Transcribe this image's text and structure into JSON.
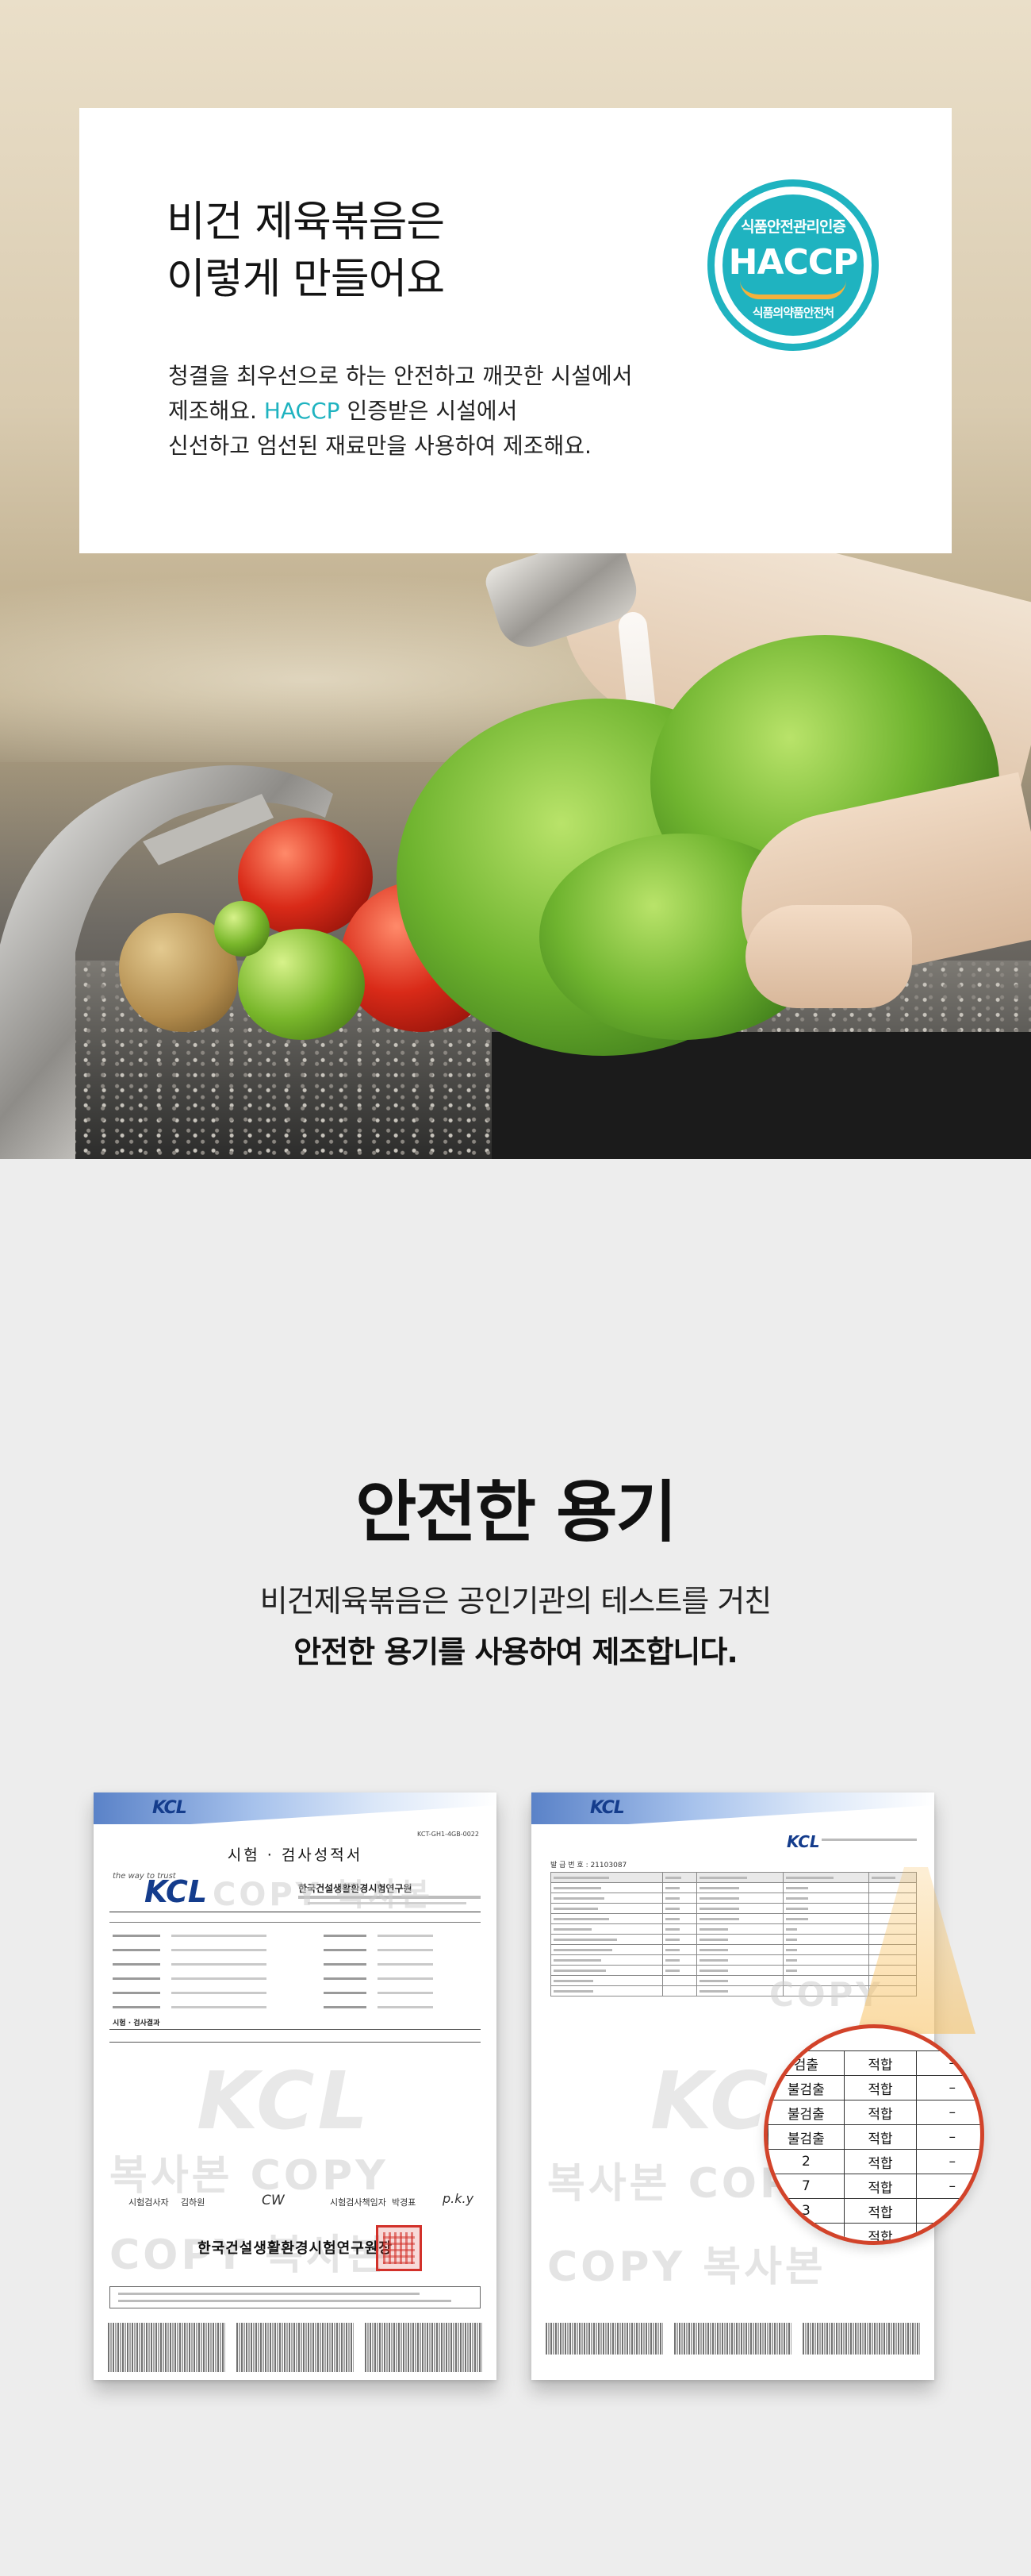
{
  "haccp_card": {
    "title_line1": "비건 제육볶음은",
    "title_line2": "이렇게 만들어요",
    "body_line1": "청결을 최우선으로 하는 안전하고 깨끗한 시설에서",
    "body_line2_before": "제조해요. ",
    "body_line2_accent": "HACCP",
    "body_line2_after": " 인증받은 시설에서",
    "body_line3": "신선하고 엄선된 재료만을 사용하여 제조해요.",
    "badge": {
      "top": "식품안전관리인증",
      "main": "HACCP",
      "bottom": "식품의약품안전처"
    },
    "accent_color": "#1fb3c0"
  },
  "safe_container": {
    "title": "안전한 용기",
    "line1": "비건제육볶음은 공인기관의 테스트를 거친",
    "line2": "안전한 용기를 사용하여 제조합니다."
  },
  "certificate_left": {
    "logo": "KCL",
    "doc_number": "KCT-GH1-4GB-0022",
    "heading": "시험 · 검사성적서",
    "tagline": "the way to trust",
    "big_logo": "KCL",
    "org_name": "한국건설생활환경시험연구원",
    "section_result": "시험 · 검사결과",
    "tester_label": "시험검사자",
    "tester_name": "김하원",
    "tester_sign": "CW",
    "approver_label": "시험검사책임자",
    "approver_name": "박경표",
    "approver_sign": "p.k.y",
    "institute": "한국건설생활환경시험연구원장",
    "watermarks": [
      "COPY 복사본",
      "KCL",
      "복사본 COPY",
      "COPY 복사본"
    ]
  },
  "certificate_right": {
    "logo": "KCL",
    "date_label": "발 급 번 호 : 21103087",
    "small_logo": "KCL",
    "watermarks": [
      "COPY",
      "KCL",
      "복사본 COPY",
      "COPY 복사본"
    ]
  },
  "magnifier_rows": [
    [
      "검출",
      "적합",
      "–"
    ],
    [
      "불검출",
      "적합",
      "–"
    ],
    [
      "불검출",
      "적합",
      "–"
    ],
    [
      "불검출",
      "적합",
      "–"
    ],
    [
      "2",
      "적합",
      "–"
    ],
    [
      "7",
      "적합",
      "–"
    ],
    [
      "3",
      "적합",
      "–"
    ],
    [
      "",
      "적합",
      ""
    ]
  ],
  "colors": {
    "magnifier_border": "#d2432a",
    "seal": "#d2312a",
    "kcl_blue": "#143c8c"
  }
}
